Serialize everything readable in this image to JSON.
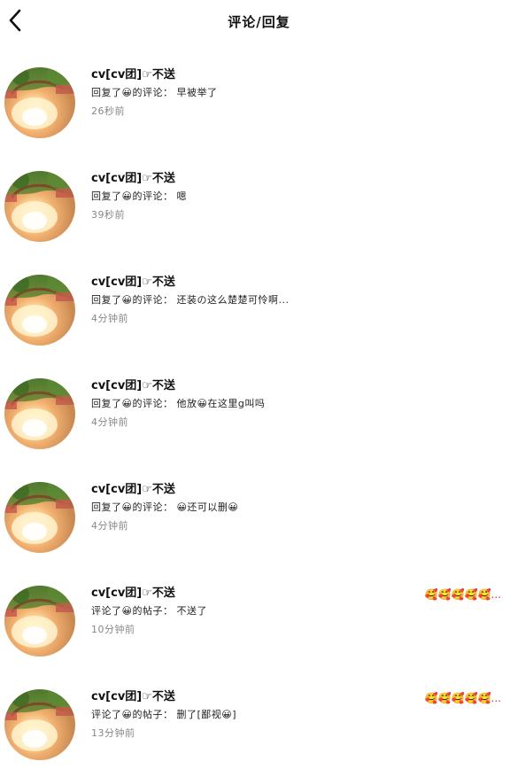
{
  "header": {
    "title": "评论/回复",
    "back_icon": "chevron-left-icon"
  },
  "items": [
    {
      "name": "cv[cv团]☞不送",
      "action": "回复了",
      "target": "的评论：",
      "content": "早被举了",
      "time": "26秒前",
      "preview": ""
    },
    {
      "name": "cv[cv团]☞不送",
      "action": "回复了",
      "target": "的评论：",
      "content": "嗯",
      "time": "39秒前",
      "preview": ""
    },
    {
      "name": "cv[cv团]☞不送",
      "action": "回复了",
      "target": "的评论：",
      "content": "还装の这么楚楚可怜啊...",
      "time": "4分钟前",
      "preview": ""
    },
    {
      "name": "cv[cv团]☞不送",
      "action": "回复了",
      "target": "的评论：",
      "content": "他放😀在这里g叫吗",
      "time": "4分钟前",
      "preview": ""
    },
    {
      "name": "cv[cv团]☞不送",
      "action": "回复了",
      "target": "的评论：",
      "content": "😀还可以删😀",
      "time": "4分钟前",
      "preview": ""
    },
    {
      "name": "cv[cv团]☞不送",
      "action": "评论了",
      "target": "的帖子：",
      "content": "不送了",
      "time": "10分钟前",
      "preview": "🥰🥰🥰🥰🥰..."
    },
    {
      "name": "cv[cv团]☞不送",
      "action": "评论了",
      "target": "的帖子：",
      "content": "删了[鄙视😀]",
      "time": "13分钟前",
      "preview": "🥰🥰🥰🥰🥰..."
    }
  ]
}
